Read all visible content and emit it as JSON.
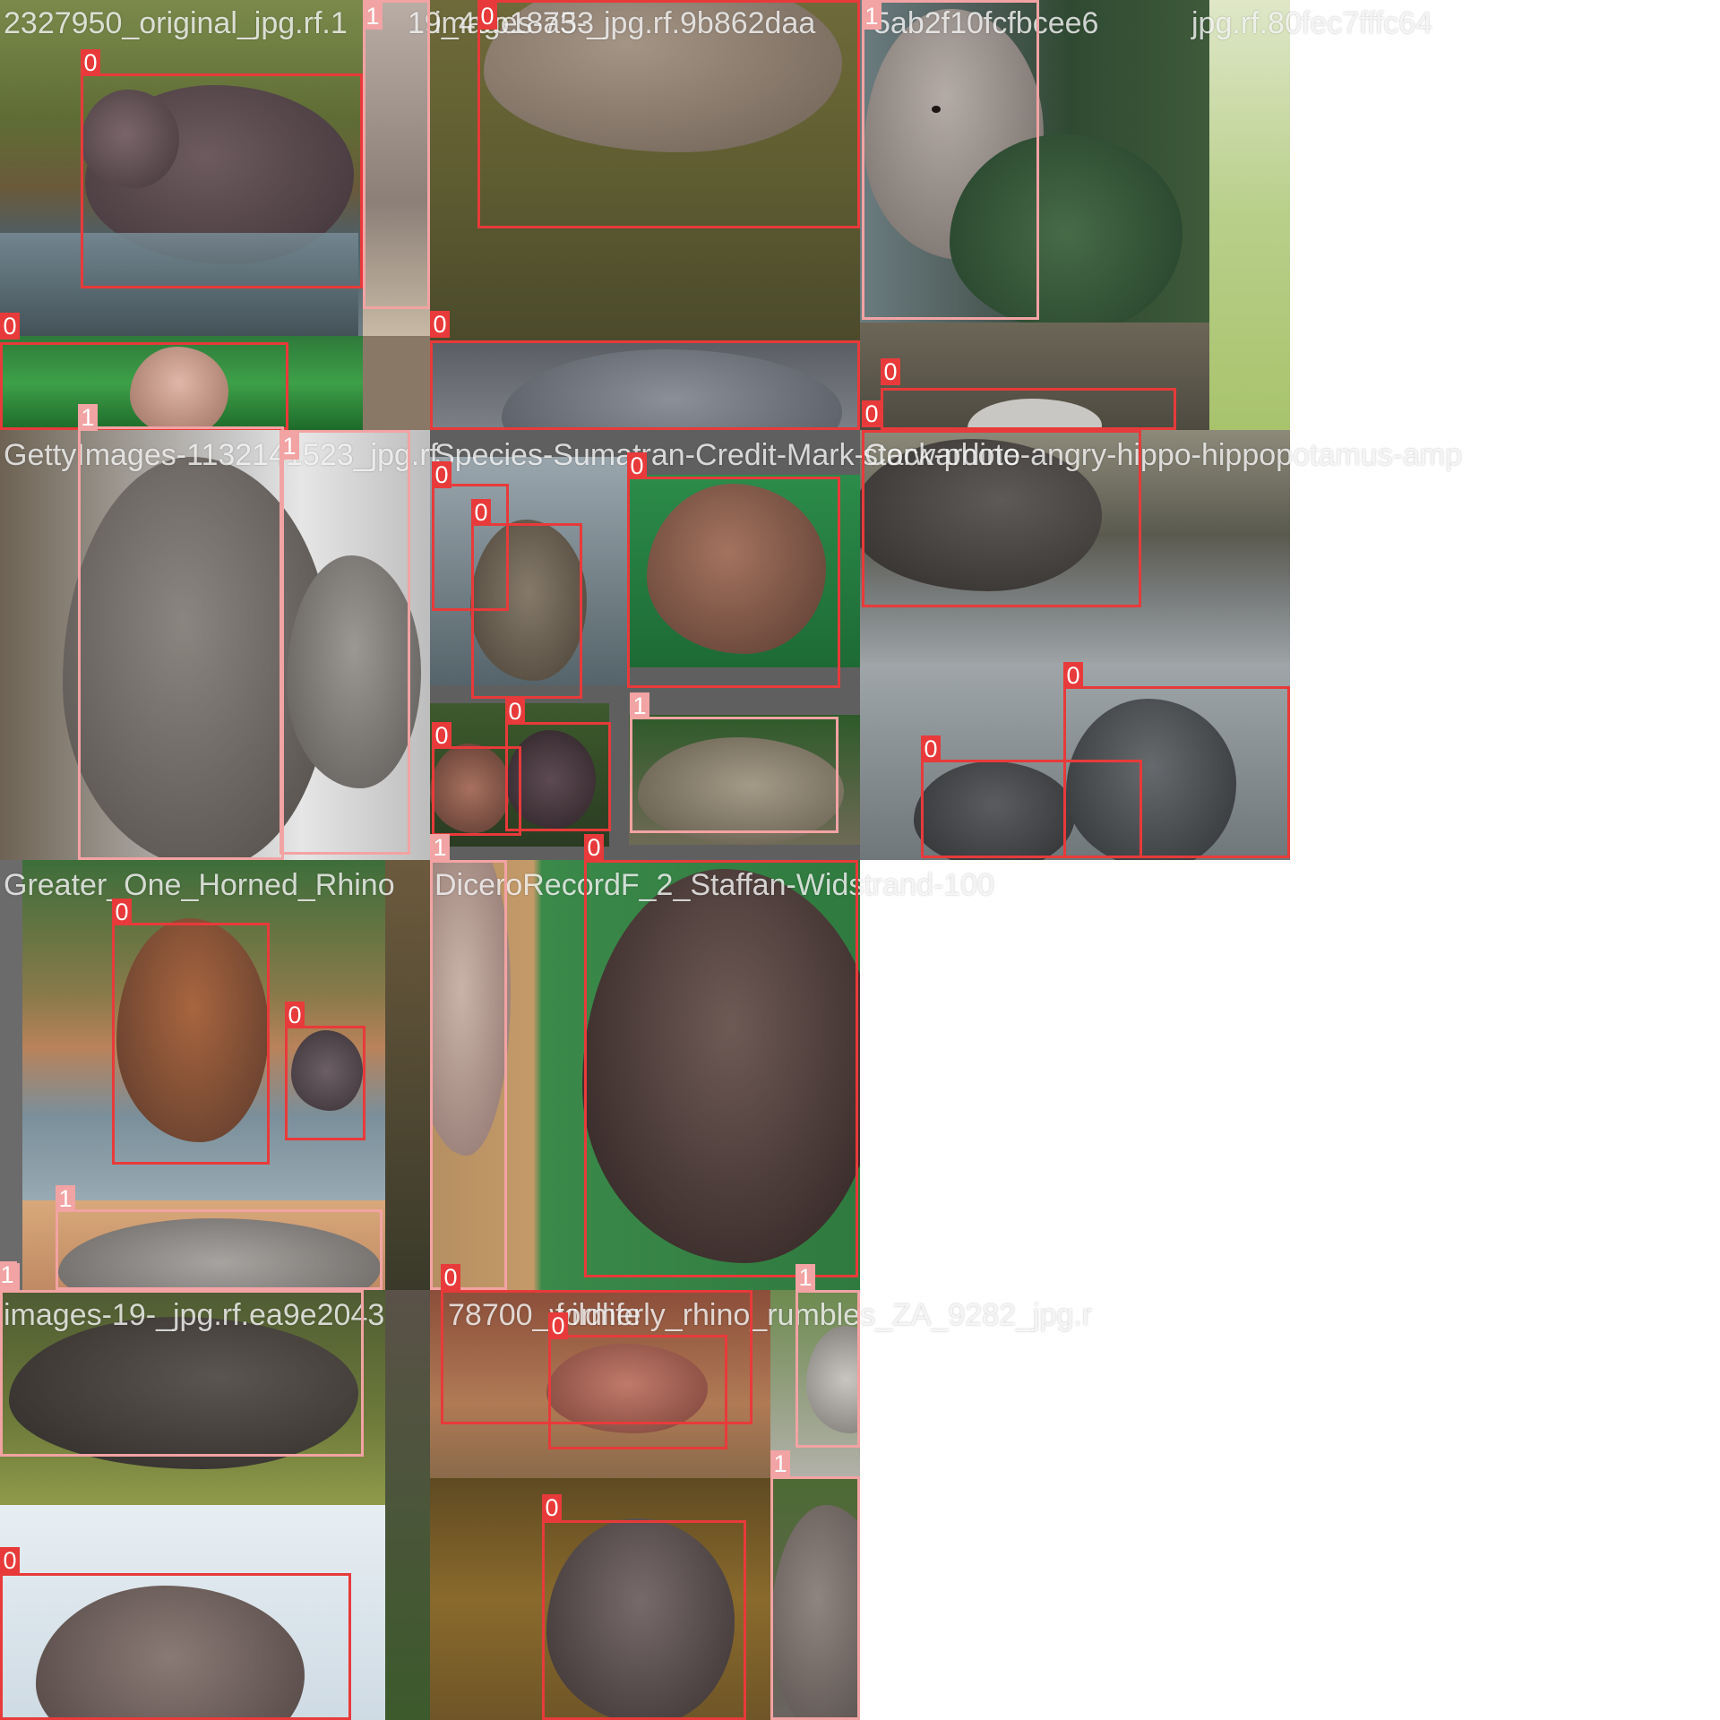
{
  "image": {
    "legend": {
      "class_0": "0",
      "class_1": "1"
    },
    "colors": {
      "class_0_box": "#e83a3a",
      "class_1_box": "#f2a3a3",
      "caption": "#ffffff"
    },
    "tiles": [
      {
        "caption": "2327950_original_jpg.rf.1",
        "labels": [
          "0",
          "1",
          "0",
          "1"
        ]
      },
      {
        "caption": "images-73-_jpg.rf.9b862daa",
        "labels": [
          "0",
          "0"
        ]
      },
      {
        "caption": "19_49b18a53",
        "labels": []
      },
      {
        "caption": "5ab2f10fcfbcee6",
        "labels": [
          "1",
          "0",
          "0"
        ]
      },
      {
        "caption": "jpg.rf.80fec7fffc64",
        "labels": []
      },
      {
        "caption": "GettyImages-1132141523_jpg.rf.",
        "labels": [
          "0",
          "1"
        ]
      },
      {
        "caption": "Species-Sumatran-Credit-Mark-Carwardine",
        "labels": [
          "0",
          "0",
          "0",
          "0",
          "0",
          "1"
        ]
      },
      {
        "caption": "stock-photo-angry-hippo-hippopotamus-amp",
        "labels": [
          "0",
          "0"
        ]
      },
      {
        "caption": "Greater_One_Horned_Rhino",
        "labels": [
          "0",
          "0",
          "1",
          "1"
        ]
      },
      {
        "caption": "DiceroRecordF_2_Staffan-Widstrand-100",
        "labels": [
          "1",
          "0",
          "1"
        ]
      },
      {
        "caption": "images-19-_jpg.rf.ea9e2043",
        "labels": [
          "0",
          "1"
        ]
      },
      {
        "caption": "78700_wildlife",
        "labels": []
      },
      {
        "caption": "formerly_rhino_rumbles_ZA_9282_jpg.r",
        "labels": [
          "0",
          "0",
          "1"
        ]
      }
    ]
  }
}
